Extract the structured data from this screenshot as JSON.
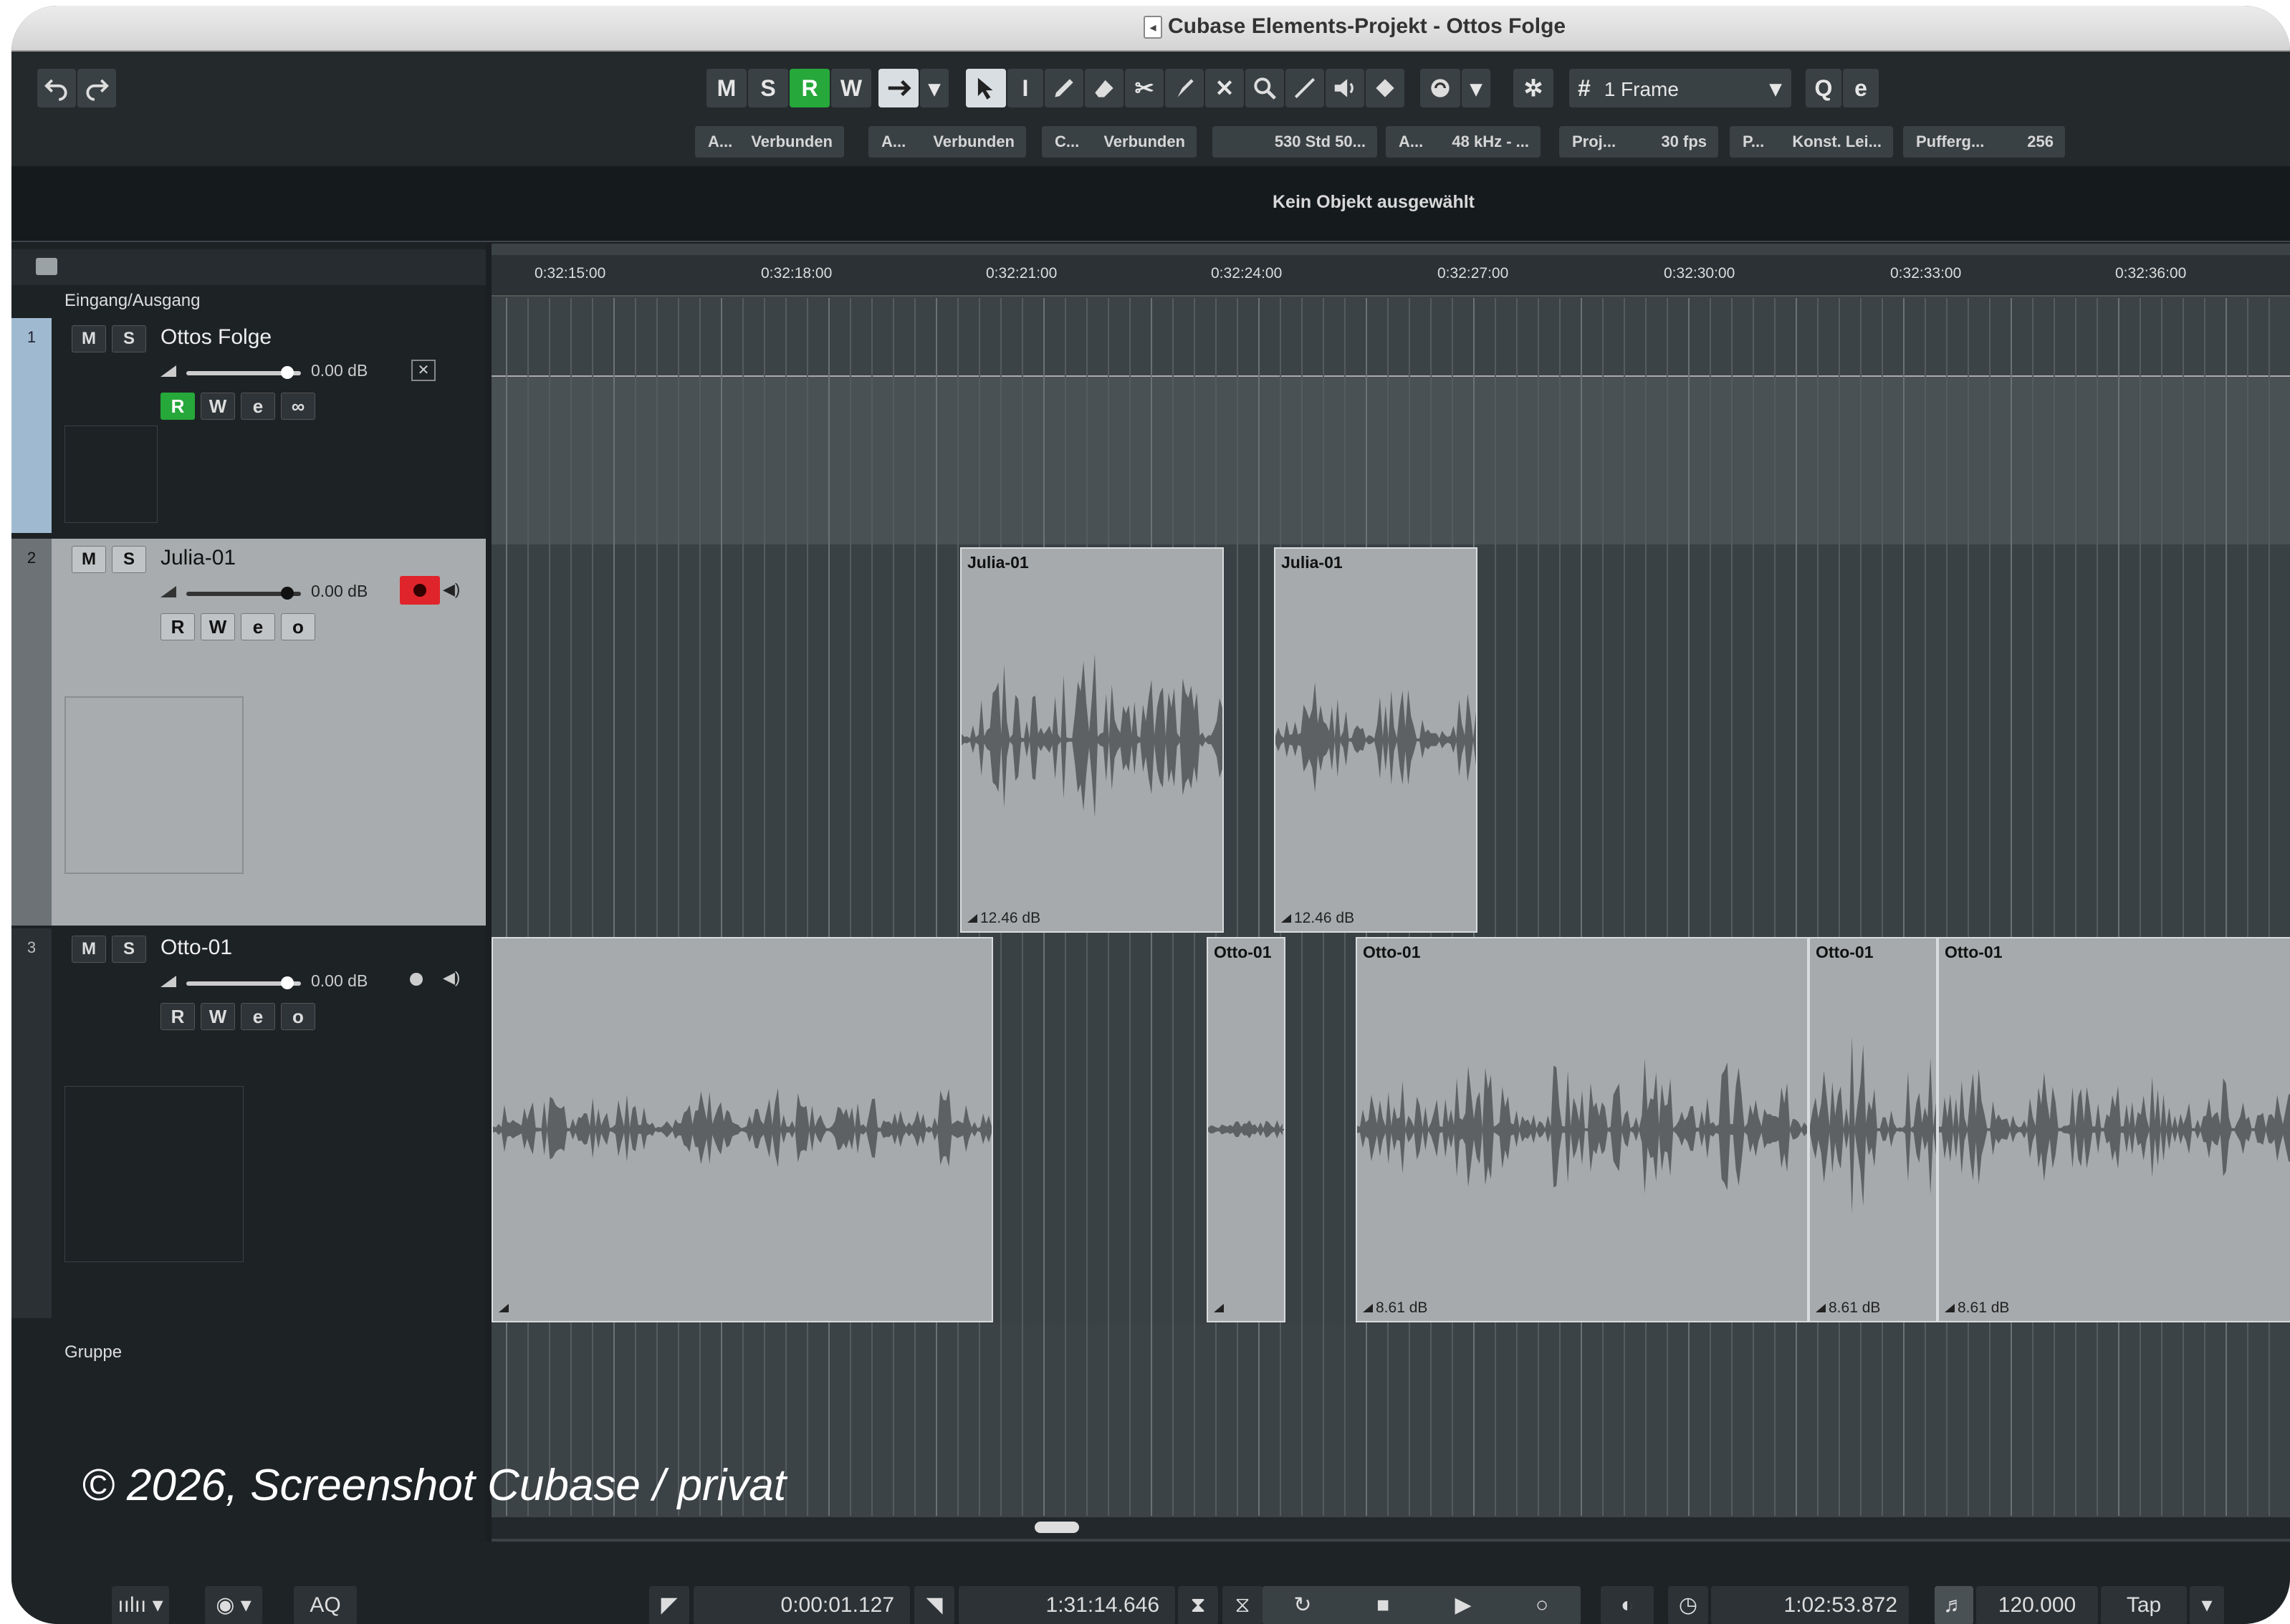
{
  "window": {
    "title": "Cubase Elements-Projekt - Ottos Folge"
  },
  "toolbar": {
    "buttons": [
      "M",
      "S",
      "R",
      "W"
    ],
    "frame_label": "1 Frame",
    "status": [
      {
        "label": "A...",
        "value": "Verbunden"
      },
      {
        "label": "A...",
        "value": "Verbunden"
      },
      {
        "label": "C...",
        "value": "Verbunden"
      },
      {
        "label": "",
        "value": "530 Std 50..."
      },
      {
        "label": "A...",
        "value": "48 kHz - ..."
      },
      {
        "label": "Proj...",
        "value": "30 fps"
      },
      {
        "label": "P...",
        "value": "Konst. Lei..."
      },
      {
        "label": "Pufferg...",
        "value": "256"
      }
    ]
  },
  "infoline": {
    "text": "Kein Objekt ausgewählt"
  },
  "inspector": {
    "header_label": "Eingang/Ausgang",
    "footer_label": "Gruppe",
    "tracks": [
      {
        "num": "1",
        "name": "Ottos Folge",
        "db": "0.00 dB"
      },
      {
        "num": "2",
        "name": "Julia-01",
        "db": "0.00 dB"
      },
      {
        "num": "3",
        "name": "Otto-01",
        "db": "0.00 dB"
      }
    ],
    "mute_label": "M",
    "solo_label": "S",
    "read_label": "R",
    "write_label": "W"
  },
  "ruler": {
    "ticks": [
      "0:32:15:00",
      "0:32:18:00",
      "0:32:21:00",
      "0:32:24:00",
      "0:32:27:00",
      "0:32:30:00",
      "0:32:33:00",
      "0:32:36:00"
    ]
  },
  "clips": {
    "julia": [
      {
        "name": "Julia-01",
        "gain": "12.46 dB"
      },
      {
        "name": "Julia-01",
        "gain": "12.46 dB"
      }
    ],
    "otto": [
      {
        "name": "",
        "gain": ""
      },
      {
        "name": "Otto-01",
        "gain": ""
      },
      {
        "name": "Otto-01",
        "gain": "8.61 dB"
      },
      {
        "name": "Otto-01",
        "gain": "8.61 dB"
      },
      {
        "name": "Otto-01",
        "gain": "8.61 dB"
      }
    ]
  },
  "transport": {
    "aq_label": "AQ",
    "left_locator": "0:00:01.127",
    "right_locator": "1:31:14.646",
    "position": "1:02:53.872",
    "tempo": "120.000",
    "tap_label": "Tap"
  },
  "watermark": "© 2026, Screenshot Cubase / privat"
}
